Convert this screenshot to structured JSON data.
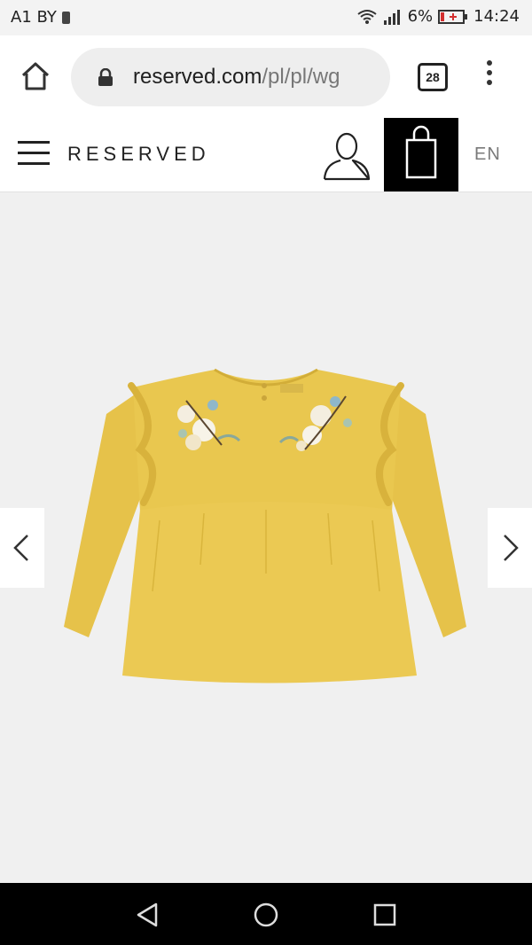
{
  "status_bar": {
    "carrier": "A1 BY",
    "battery": "6%",
    "time": "14:24"
  },
  "browser": {
    "url_domain": "reserved.com",
    "url_path": "/pl/pl/wg",
    "tab_count": "28"
  },
  "site_header": {
    "logo": "RESERVED",
    "language": "EN"
  },
  "product": {
    "image_alt": "Yellow long-sleeve baby top with ruffles and floral embroidery",
    "color": "#E9C74F"
  },
  "icons": {
    "home": "home-icon",
    "lock": "lock-icon",
    "menu": "more-vert-icon",
    "hamburger": "hamburger-menu-icon",
    "account": "user-icon",
    "bag": "shopping-bag-icon",
    "prev": "chevron-left-icon",
    "next": "chevron-right-icon",
    "back": "android-back-icon",
    "home_nav": "android-home-icon",
    "recents": "android-recents-icon"
  }
}
